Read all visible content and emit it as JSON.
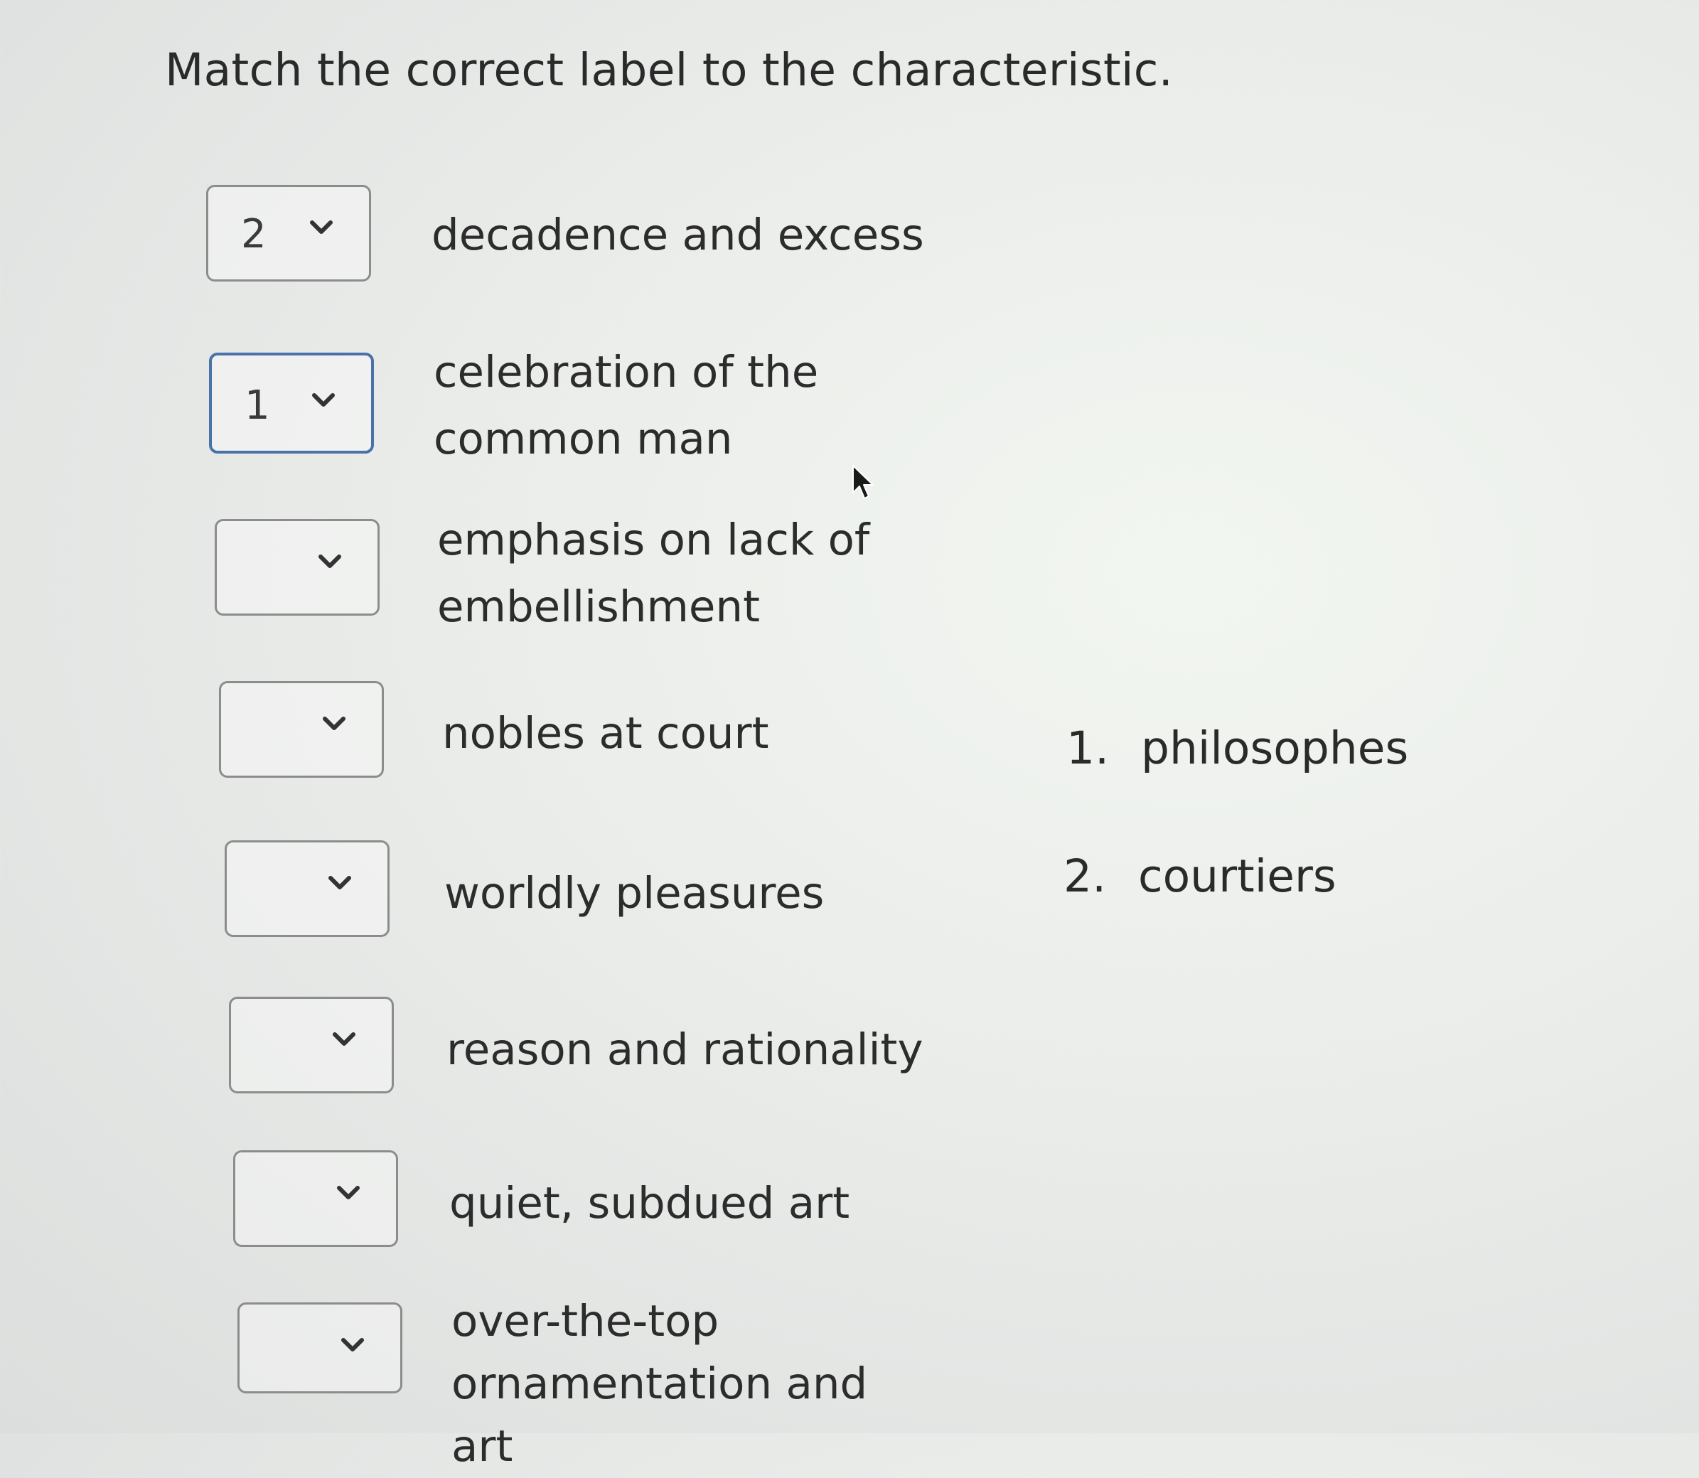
{
  "question": "Match the correct label to the characteristic.",
  "rows": [
    {
      "selected": "2",
      "label": "decadence and excess"
    },
    {
      "selected": "1",
      "label": "celebration of the common man"
    },
    {
      "selected": "",
      "label": "emphasis on lack of embellishment"
    },
    {
      "selected": "",
      "label": "nobles at court"
    },
    {
      "selected": "",
      "label": "worldly pleasures"
    },
    {
      "selected": "",
      "label": "reason and rationality"
    },
    {
      "selected": "",
      "label": "quiet, subdued art"
    },
    {
      "selected": "",
      "label": "over-the-top ornamentation and art"
    }
  ],
  "options": [
    {
      "number": "1.",
      "text": "philosophes"
    },
    {
      "number": "2.",
      "text": "courtiers"
    }
  ],
  "colors": {
    "focus_border": "#4a72a8",
    "select_border": "#8c8c8c",
    "text": "#2c2c2c"
  },
  "icons": {
    "dropdown": "chevron-down-icon",
    "cursor": "mouse-pointer-icon"
  }
}
